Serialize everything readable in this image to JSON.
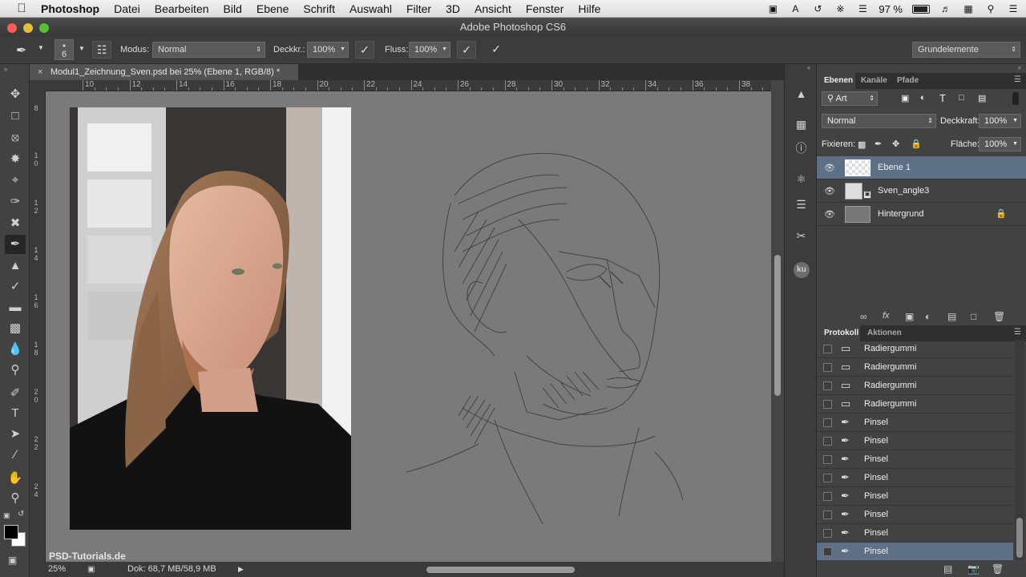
{
  "menubar": {
    "apple": "",
    "app_name": "Photoshop",
    "items": [
      "Datei",
      "Bearbeiten",
      "Bild",
      "Ebene",
      "Schrift",
      "Auswahl",
      "Filter",
      "3D",
      "Ansicht",
      "Fenster",
      "Hilfe"
    ],
    "battery": "97 %"
  },
  "window": {
    "title": "Adobe Photoshop CS6"
  },
  "options": {
    "brush_size": "6",
    "mode_label": "Modus:",
    "mode_value": "Normal",
    "opacity_label": "Deckkr.:",
    "opacity_value": "100%",
    "flow_label": "Fluss:",
    "flow_value": "100%",
    "workspace": "Grundelemente"
  },
  "document": {
    "tab_title": "Modul1_Zeichnung_Sven.psd bei 25% (Ebene 1, RGB/8) *",
    "ruler_h": [
      "10",
      "12",
      "14",
      "16",
      "18",
      "20",
      "22",
      "24",
      "26",
      "28",
      "30",
      "32",
      "34",
      "36",
      "38"
    ],
    "ruler_v": [
      "8",
      "1\n0",
      "1\n2",
      "1\n4",
      "1\n6",
      "1\n8",
      "2\n0",
      "2\n2",
      "2\n4"
    ],
    "zoom": "25%",
    "doc_size": "Dok: 68,7 MB/58,9 MB",
    "watermark": "PSD-Tutorials.de"
  },
  "layers_panel": {
    "tabs": [
      "Ebenen",
      "Kanäle",
      "Pfade"
    ],
    "filter": "Art",
    "blend": "Normal",
    "opacity_label": "Deckkraft:",
    "opacity": "100%",
    "lock_label": "Fixieren:",
    "fill_label": "Fläche:",
    "fill": "100%",
    "layers": [
      {
        "name": "Ebene 1",
        "selected": true
      },
      {
        "name": "Sven_angle3",
        "selected": false
      },
      {
        "name": "Hintergrund",
        "selected": false
      }
    ]
  },
  "history_panel": {
    "tabs": [
      "Protokoll",
      "Aktionen"
    ],
    "items": [
      {
        "name": "Radiergummi",
        "icon": "eraser-icon"
      },
      {
        "name": "Radiergummi",
        "icon": "eraser-icon"
      },
      {
        "name": "Radiergummi",
        "icon": "eraser-icon"
      },
      {
        "name": "Radiergummi",
        "icon": "eraser-icon"
      },
      {
        "name": "Pinsel",
        "icon": "brush-icon"
      },
      {
        "name": "Pinsel",
        "icon": "brush-icon"
      },
      {
        "name": "Pinsel",
        "icon": "brush-icon"
      },
      {
        "name": "Pinsel",
        "icon": "brush-icon"
      },
      {
        "name": "Pinsel",
        "icon": "brush-icon"
      },
      {
        "name": "Pinsel",
        "icon": "brush-icon"
      },
      {
        "name": "Pinsel",
        "icon": "brush-icon"
      },
      {
        "name": "Pinsel",
        "icon": "brush-icon",
        "selected": true
      }
    ]
  },
  "strip": {
    "ku": "ku"
  },
  "colors": {
    "selection": "#5e7086",
    "canvas": "#7a7a7a",
    "panel": "#424242"
  }
}
